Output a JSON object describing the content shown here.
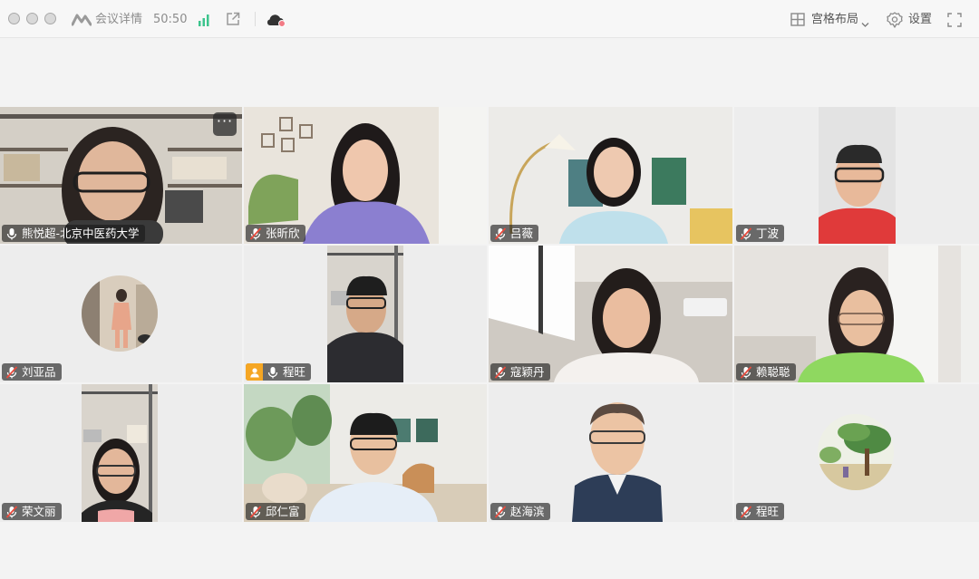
{
  "window": {
    "meeting_info_label": "会议详情",
    "elapsed_time": "50:50",
    "layout_label": "宫格布局",
    "settings_label": "设置"
  },
  "icons": {
    "close": "traffic-light",
    "logo": "tencent-meeting-logo",
    "signal": "signal-bars-icon",
    "share": "external-share-icon",
    "cloud": "cloud-record-icon",
    "grid": "grid-layout-icon",
    "gear": "gear-icon",
    "fullscreen": "fullscreen-icon"
  },
  "colors": {
    "signal_green": "#3cc48c",
    "host_badge": "#f5a623",
    "muted_red": "#e84a3c"
  },
  "participants": [
    {
      "name": "熊悦超-北京中医药大学",
      "mic": "on"
    },
    {
      "name": "张昕欣",
      "mic": "muted"
    },
    {
      "name": "吕薇",
      "mic": "muted"
    },
    {
      "name": "丁波",
      "mic": "muted"
    },
    {
      "name": "刘亚品",
      "mic": "muted"
    },
    {
      "name": "程旺",
      "mic": "on",
      "host": true
    },
    {
      "name": "寇颖丹",
      "mic": "muted"
    },
    {
      "name": "赖聪聪",
      "mic": "muted"
    },
    {
      "name": "荣文丽",
      "mic": "muted"
    },
    {
      "name": "邱仁富",
      "mic": "muted"
    },
    {
      "name": "赵海滨",
      "mic": "muted"
    },
    {
      "name": "程旺",
      "mic": "muted"
    }
  ],
  "more_label": "···"
}
